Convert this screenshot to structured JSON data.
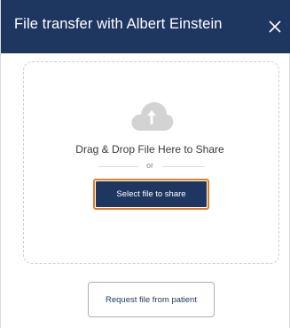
{
  "dialog": {
    "title": "File transfer with Albert Einstein",
    "close_icon": "close-icon"
  },
  "drop_zone": {
    "cloud_icon": "cloud-upload-icon",
    "label": "Drag & Drop File Here to Share",
    "separator": "or",
    "select_button_label": "Select file to share"
  },
  "request_button_label": "Request file from patient",
  "colors": {
    "header_bg": "#1e3761",
    "accent_focus": "#e87d1e",
    "primary_button": "#1e3761"
  }
}
